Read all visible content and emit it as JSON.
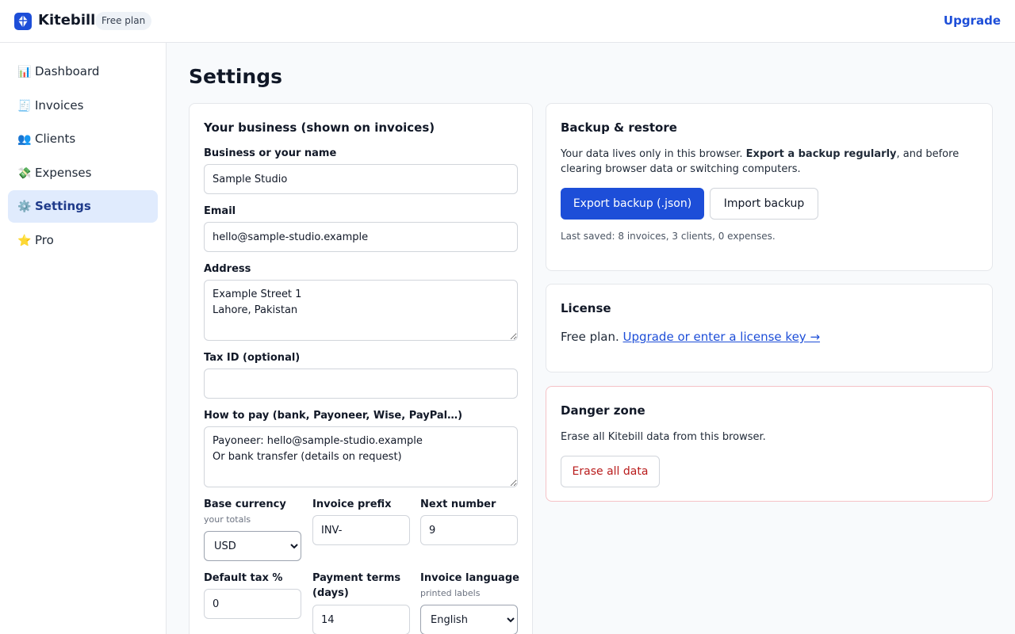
{
  "app": {
    "name": "Kitebill",
    "plan_badge": "Free plan",
    "upgrade_label": "Upgrade"
  },
  "sidebar": {
    "items": [
      {
        "icon": "📊",
        "label": "Dashboard"
      },
      {
        "icon": "🧾",
        "label": "Invoices"
      },
      {
        "icon": "👥",
        "label": "Clients"
      },
      {
        "icon": "💸",
        "label": "Expenses"
      },
      {
        "icon": "⚙️",
        "label": "Settings"
      },
      {
        "icon": "⭐",
        "label": "Pro"
      }
    ]
  },
  "page": {
    "title": "Settings"
  },
  "business": {
    "title": "Your business (shown on invoices)",
    "name_label": "Business or your name",
    "name_value": "Sample Studio",
    "email_label": "Email",
    "email_value": "hello@sample-studio.example",
    "address_label": "Address",
    "address_value": "Example Street 1\nLahore, Pakistan",
    "taxid_label": "Tax ID (optional)",
    "taxid_value": "",
    "pay_label": "How to pay (bank, Payoneer, Wise, PayPal…)",
    "pay_value": "Payoneer: hello@sample-studio.example\nOr bank transfer (details on request)",
    "currency_label": "Base currency",
    "currency_hint": "your totals",
    "currency_value": "USD",
    "prefix_label": "Invoice prefix",
    "prefix_value": "INV-",
    "next_label": "Next number",
    "next_value": "9",
    "tax_label": "Default tax %",
    "tax_value": "0",
    "terms_label": "Payment terms (days)",
    "terms_value": "14",
    "language_label": "Invoice language",
    "language_hint": "printed labels",
    "language_value": "English"
  },
  "backup": {
    "title": "Backup & restore",
    "desc_start": "Your data lives only in this browser. ",
    "desc_bold": "Export a backup regularly",
    "desc_end": ", and before clearing browser data or switching computers.",
    "export_label": "Export backup (.json)",
    "import_label": "Import backup",
    "last_saved": "Last saved: 8 invoices, 3 clients, 0 expenses."
  },
  "license": {
    "title": "License",
    "text": "Free plan.",
    "link": "Upgrade or enter a license key →"
  },
  "danger": {
    "title": "Danger zone",
    "desc": "Erase all Kitebill data from this browser.",
    "erase_label": "Erase all data"
  }
}
